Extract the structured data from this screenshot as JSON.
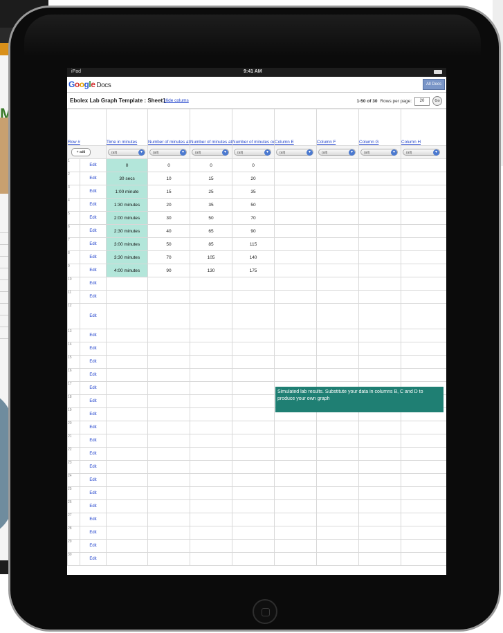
{
  "status_bar": {
    "device": "iPad",
    "time": "9:41 AM"
  },
  "app": {
    "logo_letters": [
      "G",
      "o",
      "o",
      "g",
      "l",
      "e"
    ],
    "logo_suffix": "Docs",
    "all_docs_label": "All Docs"
  },
  "sheet": {
    "title": "Ebolex Lab Graph Template : Sheet1",
    "hide_columns_label": "Hide colums",
    "range_count": "1-50 of 30",
    "rows_per_page_label": "Rows per page:",
    "rows_per_page_value": "20",
    "go_label": "Go"
  },
  "columns": [
    "Row #",
    "Time in minutes",
    "Number of minutes at Desk",
    "Number of minutes at window",
    "Number of minutes outside",
    "Column E",
    "Column F",
    "Column G",
    "Column H"
  ],
  "filters": {
    "add_label": "+ add",
    "dropdown_label": "(all)"
  },
  "edit_label": "Edit",
  "rows": [
    {
      "n": "1",
      "time": "0",
      "b": "0",
      "c": "0",
      "d": "0"
    },
    {
      "n": "2",
      "time": "30 secs",
      "b": "10",
      "c": "15",
      "d": "20"
    },
    {
      "n": "3",
      "time": "1:00 minute",
      "b": "15",
      "c": "25",
      "d": "35"
    },
    {
      "n": "4",
      "time": "1:30 minutes",
      "b": "20",
      "c": "35",
      "d": "50"
    },
    {
      "n": "5",
      "time": "2:00 minutes",
      "b": "30",
      "c": "50",
      "d": "70"
    },
    {
      "n": "6",
      "time": "2:30 minutes",
      "b": "40",
      "c": "65",
      "d": "90"
    },
    {
      "n": "7",
      "time": "3:00 minutes",
      "b": "50",
      "c": "85",
      "d": "115"
    },
    {
      "n": "8",
      "time": "3:30 minutes",
      "b": "70",
      "c": "105",
      "d": "140"
    },
    {
      "n": "9",
      "time": "4:00 minutes",
      "b": "90",
      "c": "130",
      "d": "175"
    },
    {
      "n": "10",
      "time": "",
      "b": "",
      "c": "",
      "d": ""
    },
    {
      "n": "11",
      "time": "",
      "b": "",
      "c": "",
      "d": ""
    },
    {
      "n": "12",
      "time": "",
      "b": "",
      "c": "",
      "d": "",
      "tall": true
    },
    {
      "n": "13"
    },
    {
      "n": "14"
    },
    {
      "n": "15"
    },
    {
      "n": "16"
    },
    {
      "n": "17"
    },
    {
      "n": "18"
    },
    {
      "n": "19"
    },
    {
      "n": "20"
    },
    {
      "n": "21"
    },
    {
      "n": "22"
    },
    {
      "n": "23"
    },
    {
      "n": "24"
    },
    {
      "n": "25"
    },
    {
      "n": "26"
    },
    {
      "n": "27"
    },
    {
      "n": "28"
    },
    {
      "n": "29"
    },
    {
      "n": "30"
    }
  ],
  "note": "Simulated lab results. Substitute your data in columns B, C and D to produce your own graph",
  "background_page": {
    "letter": "M"
  },
  "colors": {
    "teal_note": "#1f7f73",
    "time_fill": "#b3e6da",
    "link_blue": "#2244cc"
  }
}
